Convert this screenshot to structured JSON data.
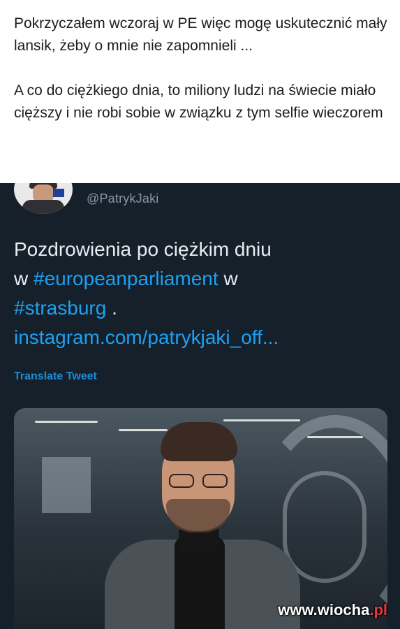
{
  "post": {
    "paragraph1": "Pokrzyczałem wczoraj w PE więc mogę uskutecznić mały lansik, żeby o mnie nie zapomnieli ...",
    "paragraph2": "A co do ciężkiego dnia, to miliony ludzi na świecie miało cięższy i nie robi sobie w związku z tym selfie wieczorem"
  },
  "tweet": {
    "handle": "@PatrykJaki",
    "text_line1": "Pozdrowienia po ciężkim dniu",
    "text_w1": "w",
    "hashtag1": "#europeanparliament",
    "text_w2": "w",
    "hashtag2": "#strasburg",
    "text_dot": ".",
    "link": "instagram.com/patrykjaki_off...",
    "translate_label": "Translate Tweet"
  },
  "watermark": {
    "main": "www.wiocha",
    "suffix": ".pl"
  },
  "colors": {
    "tweet_background": "#15202b",
    "accent_blue": "#1da1f2",
    "handle_gray": "#8899a6"
  }
}
